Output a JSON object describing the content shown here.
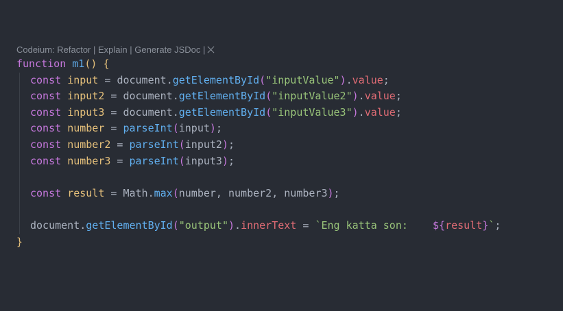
{
  "codelens": {
    "prefix": "Codeium: ",
    "refactor": "Refactor",
    "sep": " | ",
    "explain": "Explain",
    "generate": "Generate JSDoc",
    "tail": " |"
  },
  "code": {
    "fn_keyword": "function",
    "fn_name": "m1",
    "open_paren": "(",
    "close_paren": ")",
    "open_brace": "{",
    "close_brace": "}",
    "kw_const": "const",
    "eq": " = ",
    "document": "document",
    "dot": ".",
    "getById": "getElementById",
    "value": "value",
    "semi": ";",
    "l1": {
      "var": "input",
      "arg": "\"inputValue\""
    },
    "l2": {
      "var": "input2",
      "arg": "\"inputValue2\""
    },
    "l3": {
      "var": "input3",
      "arg": "\"inputValue3\""
    },
    "parseInt": "parseInt",
    "l4": {
      "var": "number",
      "arg": "input"
    },
    "l5": {
      "var": "number2",
      "arg": "input2"
    },
    "l6": {
      "var": "number3",
      "arg": "input3"
    },
    "l8": {
      "var": "result",
      "math": "Math",
      "max": "max",
      "args": "number, number2, number3"
    },
    "l10": {
      "arg": "\"output\"",
      "prop": "innerText",
      "tpl_open": "`Eng katta son:    ",
      "interp_open": "${",
      "interp_var": "result",
      "interp_close": "}",
      "tpl_close": "`"
    }
  },
  "colors": {
    "background": "#282c34",
    "keyword": "#c678dd",
    "function": "#61afef",
    "variable": "#e5c07b",
    "string": "#98c379",
    "property": "#e06c75",
    "text": "#abb2bf",
    "codelens": "#8b919b"
  },
  "icons": {
    "codelens_close": "close-icon"
  }
}
